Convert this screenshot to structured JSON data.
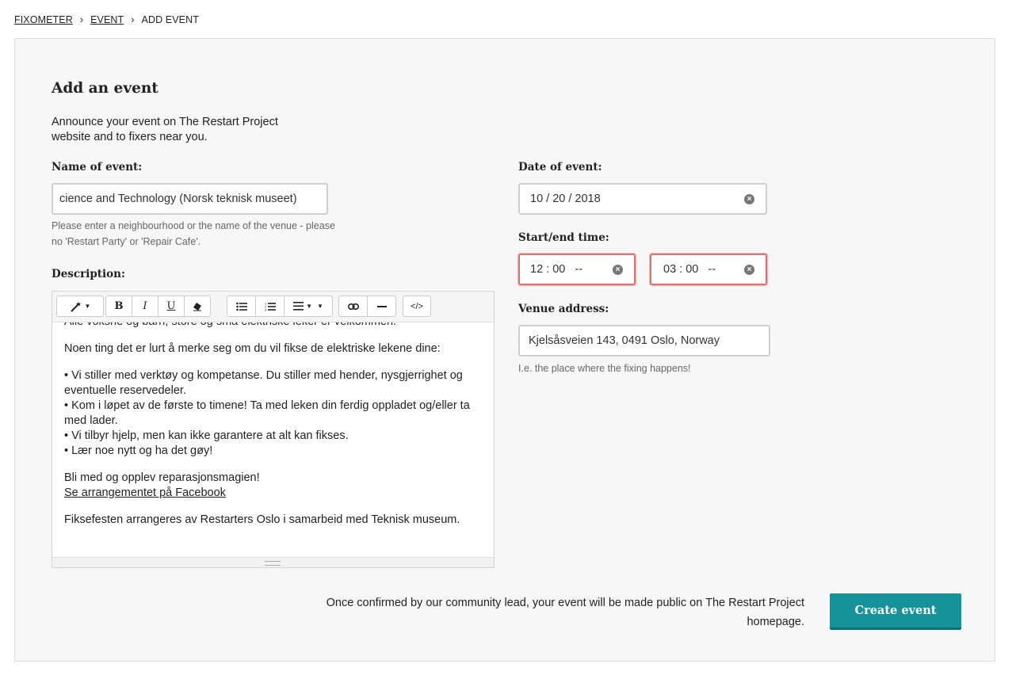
{
  "breadcrumb": {
    "items": [
      {
        "label": "FIXOMETER"
      },
      {
        "label": "EVENT"
      },
      {
        "label": "ADD EVENT"
      }
    ],
    "separator": "›"
  },
  "form": {
    "title": "Add an event",
    "intro": "Announce your event on The Restart Project website and to fixers near you.",
    "name": {
      "label": "Name of event:",
      "value": "cience and Technology (Norsk teknisk museet)",
      "help": "Please enter a neighbourhood or the name of the venue - please no 'Restart Party' or 'Repair Cafe'."
    },
    "description": {
      "label": "Description:",
      "toolbar": {
        "magic": "magic-wand-icon",
        "bold": "B",
        "italic": "I",
        "underline": "U",
        "eraser": "eraser-icon",
        "ul": "unordered-list-icon",
        "ol": "ordered-list-icon",
        "align": "align-icon",
        "link": "link-icon",
        "hr": "horizontal-rule-icon",
        "code": "</>"
      },
      "paragraphs": [
        [
          "Alle voksne og barn, store og små elektriske leker er velkommen."
        ],
        [
          "Noen ting det er lurt å merke seg om du vil fikse de elektriske lekene dine:"
        ],
        [
          "• Vi stiller med verktøy og kompetanse. Du stiller med hender, nysgjerrighet og eventuelle reservedeler.",
          "• Kom i løpet av de første to timene! Ta med leken din ferdig oppladet og/eller ta med lader.",
          "• Vi tilbyr hjelp, men kan ikke garantere at alt kan fikses.",
          "• Lær noe nytt og ha det gøy!"
        ],
        [
          "Bli med og opplev reparasjonsmagien!",
          "Se arrangementet på Facebook"
        ],
        [
          "Fiksefesten arrangeres av Restarters Oslo i samarbeid med Teknisk museum."
        ]
      ]
    },
    "date": {
      "label": "Date of event:",
      "value": "10 / 20 / 2018"
    },
    "time": {
      "label": "Start/end time:",
      "start": "12 : 00   --",
      "end": "03 : 00   --"
    },
    "venue": {
      "label": "Venue address:",
      "value": "Kjelsåsveien 143, 0491 Oslo, Norway",
      "help": "I.e. the place where the fixing happens!"
    },
    "footer_note": "Once confirmed by our community lead, your event will be made public on The Restart Project homepage.",
    "submit_label": "Create event"
  },
  "colors": {
    "accent": "#15939a",
    "error_border": "#e0706e",
    "panel_bg": "#f7f7f7"
  }
}
